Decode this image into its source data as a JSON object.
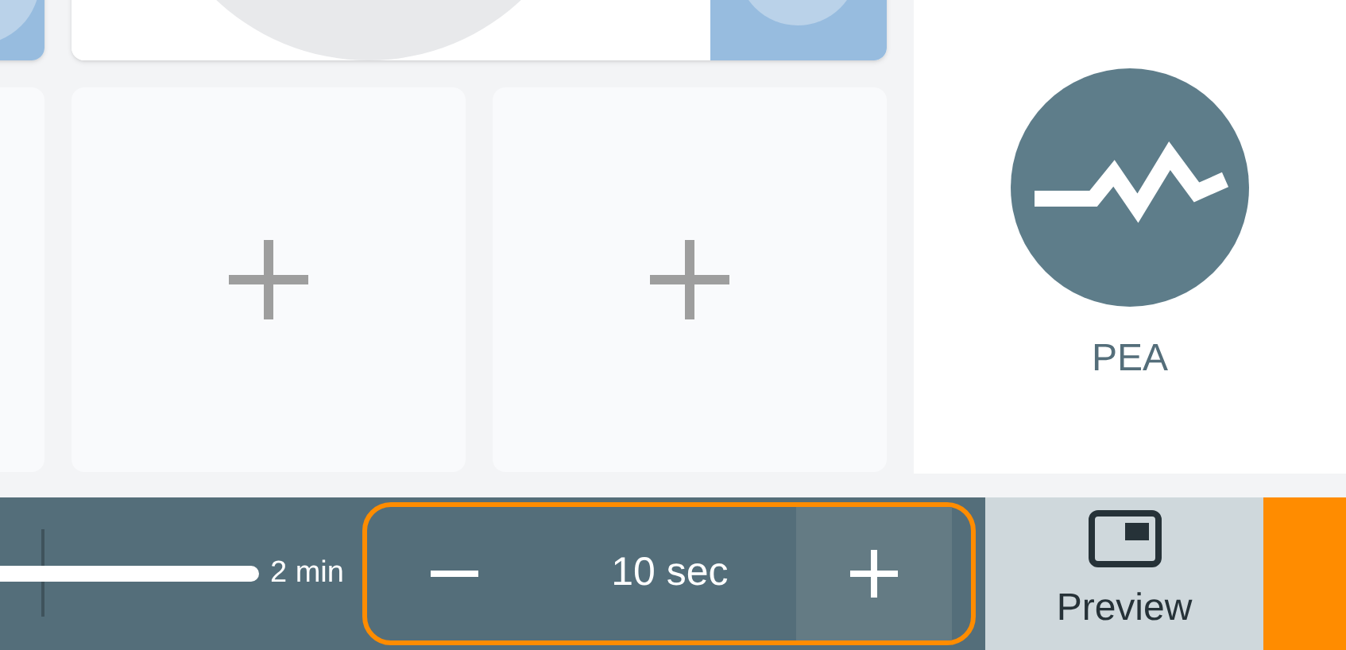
{
  "tiles": [
    {
      "kind": "picture"
    },
    {
      "kind": "picture",
      "wide": true
    },
    {
      "kind": "blank"
    },
    {
      "kind": "add"
    },
    {
      "kind": "add"
    }
  ],
  "rhythm": {
    "label": "PEA"
  },
  "duration_slider": {
    "max_label": "2 min"
  },
  "interval_stepper": {
    "value": "10 sec"
  },
  "preview_button": {
    "label": "Preview"
  }
}
